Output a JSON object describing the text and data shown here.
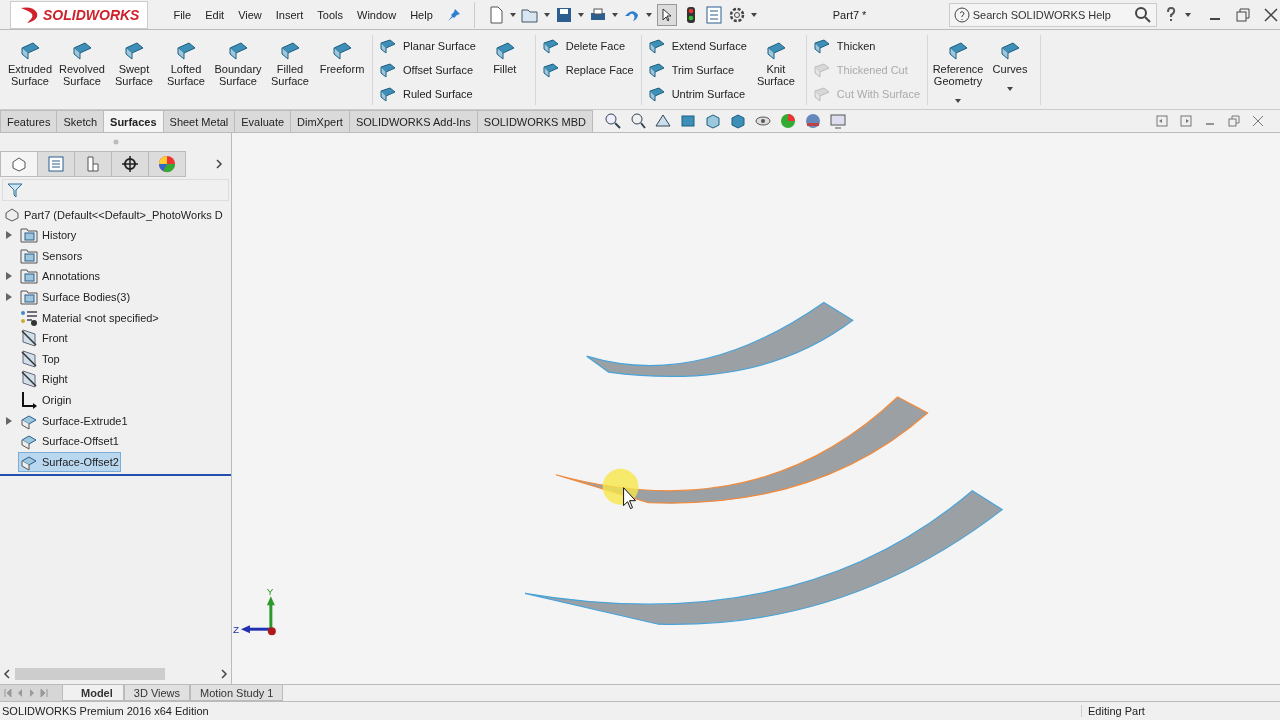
{
  "app": {
    "logo": "SOLIDWORKS",
    "menu": [
      "File",
      "Edit",
      "View",
      "Insert",
      "Tools",
      "Window",
      "Help"
    ],
    "document_title": "Part7 *",
    "search": {
      "placeholder": "Search SOLIDWORKS Help"
    }
  },
  "ribbon": {
    "groups": [
      {
        "columns": [
          {
            "kind": "big",
            "label": "Extruded Surface",
            "disabled": false
          },
          {
            "kind": "big",
            "label": "Revolved Surface",
            "disabled": false
          },
          {
            "kind": "big",
            "label": "Swept Surface",
            "disabled": false
          },
          {
            "kind": "big",
            "label": "Lofted Surface",
            "disabled": false
          },
          {
            "kind": "big",
            "label": "Boundary Surface",
            "disabled": false
          },
          {
            "kind": "big",
            "label": "Filled Surface",
            "disabled": false
          },
          {
            "kind": "big",
            "label": "Freeform",
            "disabled": false
          }
        ]
      },
      {
        "columns": [
          {
            "kind": "stack",
            "commands": [
              {
                "label": "Planar Surface",
                "disabled": false
              },
              {
                "label": "Offset Surface",
                "disabled": false
              },
              {
                "label": "Ruled Surface",
                "disabled": false
              }
            ]
          },
          {
            "kind": "big",
            "label": "Fillet",
            "disabled": false
          }
        ]
      },
      {
        "columns": [
          {
            "kind": "stack",
            "commands": [
              {
                "label": "Delete Face",
                "disabled": false
              },
              {
                "label": "Replace Face",
                "disabled": false
              }
            ]
          }
        ]
      },
      {
        "columns": [
          {
            "kind": "stack",
            "commands": [
              {
                "label": "Extend Surface",
                "disabled": false
              },
              {
                "label": "Trim Surface",
                "disabled": false
              },
              {
                "label": "Untrim Surface",
                "disabled": false
              }
            ]
          },
          {
            "kind": "big",
            "label": "Knit Surface",
            "disabled": false
          }
        ]
      },
      {
        "columns": [
          {
            "kind": "stack",
            "commands": [
              {
                "label": "Thicken",
                "disabled": false
              },
              {
                "label": "Thickened Cut",
                "disabled": true
              },
              {
                "label": "Cut With Surface",
                "disabled": true
              }
            ]
          }
        ]
      },
      {
        "columns": [
          {
            "kind": "dropdown",
            "label": "Reference Geometry",
            "disabled": false
          },
          {
            "kind": "dropdown",
            "label": "Curves",
            "disabled": false
          }
        ]
      }
    ]
  },
  "tabs": [
    {
      "label": "Features",
      "selected": false
    },
    {
      "label": "Sketch",
      "selected": false
    },
    {
      "label": "Surfaces",
      "selected": true
    },
    {
      "label": "Sheet Metal",
      "selected": false
    },
    {
      "label": "Evaluate",
      "selected": false
    },
    {
      "label": "DimXpert",
      "selected": false
    },
    {
      "label": "SOLIDWORKS Add-Ins",
      "selected": false
    },
    {
      "label": "SOLIDWORKS MBD",
      "selected": false
    }
  ],
  "panel_tabs": [
    {
      "selected": true
    },
    {
      "selected": false
    },
    {
      "selected": false
    },
    {
      "selected": false
    },
    {
      "selected": false
    }
  ],
  "tree": {
    "root": "Part7  (Default<<Default>_PhotoWorks D",
    "items": [
      {
        "label": "History",
        "kind": "folder",
        "expandable": true,
        "selected": false
      },
      {
        "label": "Sensors",
        "kind": "folder",
        "expandable": false,
        "selected": false
      },
      {
        "label": "Annotations",
        "kind": "folder",
        "expandable": true,
        "selected": false
      },
      {
        "label": "Surface Bodies(3)",
        "kind": "folder",
        "expandable": true,
        "selected": false
      },
      {
        "label": "Material <not specified>",
        "kind": "material",
        "expandable": false,
        "selected": false
      },
      {
        "label": "Front",
        "kind": "plane",
        "expandable": false,
        "selected": false
      },
      {
        "label": "Top",
        "kind": "plane",
        "expandable": false,
        "selected": false
      },
      {
        "label": "Right",
        "kind": "plane",
        "expandable": false,
        "selected": false
      },
      {
        "label": "Origin",
        "kind": "origin",
        "expandable": false,
        "selected": false
      },
      {
        "label": "Surface-Extrude1",
        "kind": "feature",
        "expandable": true,
        "selected": false
      },
      {
        "label": "Surface-Offset1",
        "kind": "feature",
        "expandable": false,
        "selected": false
      },
      {
        "label": "Surface-Offset2",
        "kind": "feature",
        "expandable": false,
        "selected": true
      }
    ]
  },
  "triad": {
    "y": "Y",
    "z": "Z"
  },
  "bottom_tabs": [
    {
      "label": "Model",
      "selected": true
    },
    {
      "label": "3D Views",
      "selected": false
    },
    {
      "label": "Motion Study 1",
      "selected": false
    }
  ],
  "status_bar": {
    "edition": "SOLIDWORKS Premium 2016 x64 Edition",
    "mode": "Editing Part"
  }
}
